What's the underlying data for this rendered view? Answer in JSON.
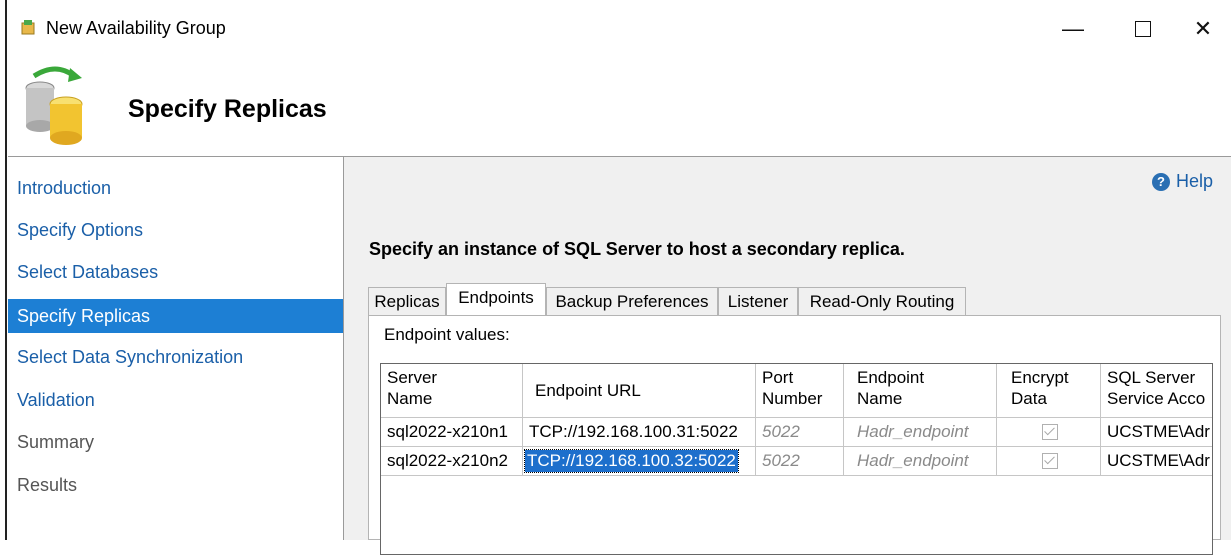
{
  "window": {
    "title": "New Availability Group"
  },
  "header": {
    "page_title": "Specify Replicas"
  },
  "sidebar": {
    "items": [
      {
        "label": "Introduction"
      },
      {
        "label": "Specify Options"
      },
      {
        "label": "Select Databases"
      },
      {
        "label": "Specify Replicas"
      },
      {
        "label": "Select Data Synchronization"
      },
      {
        "label": "Validation"
      },
      {
        "label": "Summary"
      },
      {
        "label": "Results"
      }
    ],
    "active": "Specify Replicas"
  },
  "help": {
    "label": "Help"
  },
  "instruction": "Specify an instance of SQL Server to host a secondary replica.",
  "tabs": [
    {
      "label": "Replicas"
    },
    {
      "label": "Endpoints"
    },
    {
      "label": "Backup Preferences"
    },
    {
      "label": "Listener"
    },
    {
      "label": "Read-Only Routing"
    }
  ],
  "selected_tab": "Endpoints",
  "panel": {
    "label": "Endpoint values:"
  },
  "grid": {
    "headers": [
      {
        "line1": "Server",
        "line2": "Name"
      },
      {
        "line1": "Endpoint URL",
        "line2": ""
      },
      {
        "line1": "Port",
        "line2": "Number"
      },
      {
        "line1": "Endpoint",
        "line2": "Name"
      },
      {
        "line1": "Encrypt",
        "line2": "Data"
      },
      {
        "line1": "SQL Server",
        "line2": "Service Acco"
      }
    ],
    "rows": [
      {
        "server": "sql2022-x210n1",
        "url": "TCP://192.168.100.31:5022",
        "port": "5022",
        "endpoint": "Hadr_endpoint",
        "encrypt": true,
        "account": "UCSTME\\Adr"
      },
      {
        "server": "sql2022-x210n2",
        "url": "TCP://192.168.100.32:5022",
        "port": "5022",
        "endpoint": "Hadr_endpoint",
        "encrypt": true,
        "account": "UCSTME\\Adr"
      }
    ],
    "selected_cell": {
      "row": 1,
      "column": "Endpoint URL"
    }
  },
  "colors": {
    "accent": "#1d7fd4",
    "link": "#1a5fa8",
    "selection": "#1d6fcc",
    "content_bg": "#f0f0f0"
  },
  "icons": [
    "availability-group-app-icon",
    "database-replica-icon",
    "help-icon",
    "minimize-icon",
    "maximize-icon",
    "close-icon",
    "checkbox-checked-icon"
  ]
}
